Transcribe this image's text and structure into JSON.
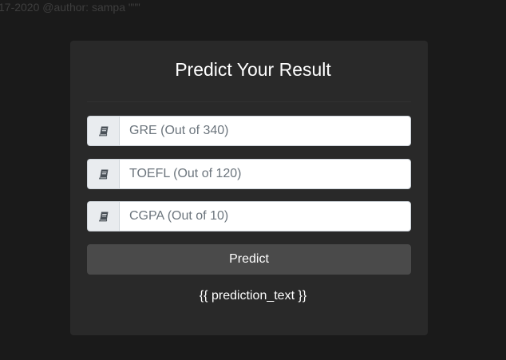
{
  "page": {
    "background_color": "#1a1a1a",
    "top_comment": "17-2020 @author: sampa \"\"\""
  },
  "card": {
    "background_color": "#292929",
    "title": "Predict Your Result",
    "inputs": [
      {
        "name": "gre",
        "placeholder": "GRE (Out of 340)",
        "value": "",
        "icon": "book-icon"
      },
      {
        "name": "toefl",
        "placeholder": "TOEFL (Out of 120)",
        "value": "",
        "icon": "book-icon"
      },
      {
        "name": "cgpa",
        "placeholder": "CGPA (Out of 10)",
        "value": "",
        "icon": "book-icon"
      }
    ],
    "predict_button_label": "Predict",
    "predict_button_color": "#4a4a4a",
    "prediction_text": "{{ prediction_text }}"
  }
}
